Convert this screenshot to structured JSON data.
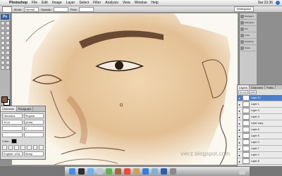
{
  "menubar": {
    "app_name": "Photoshop",
    "items": [
      "File",
      "Edit",
      "Image",
      "Layer",
      "Select",
      "Filter",
      "Analysis",
      "View",
      "Window",
      "Help"
    ],
    "clock": "Sat 23:36"
  },
  "optionsbar": {
    "mode_label": "Mode:",
    "mode_value": "Normal",
    "opacity_label": "Opacity:",
    "flow_label": "Flow:",
    "workspace_label": "Workspace"
  },
  "toolbox": {
    "badge": "Ps"
  },
  "character_panel": {
    "tabs": [
      "Character",
      "Paragraph"
    ],
    "font_family": "Helvetica",
    "font_style": "Regular",
    "size": "12 pt",
    "leading": "(Auto)",
    "tracking": "0",
    "color_label": "Color:",
    "language": "English: USA",
    "aa": "Sharp"
  },
  "right_dock": {
    "items": [
      "Navigator",
      "Histogram",
      "Info",
      "Color",
      "Swatches",
      "Styles"
    ]
  },
  "layers_panel": {
    "tabs": [
      "Layers",
      "Channels",
      "Paths"
    ],
    "blend": "Normal",
    "opacity": "100%",
    "layers": [
      "Layer 10",
      "Layer 1",
      "Layer 3",
      "Layer 9",
      "Layer copy",
      "Layer 6",
      "Layer 5",
      "Layer 4",
      "Layer 7",
      "Layer 2",
      "Layer 8"
    ]
  },
  "watermark": "vierz.blogspot.com",
  "colors": {
    "skin": "#e8c9a0",
    "shadow": "#b98257",
    "hair": "#6b4a34",
    "layer_selected": "#4d7cc9"
  },
  "dock": {
    "apps": [
      "Finder",
      "Dashboard",
      "Safari",
      "Mail",
      "iChat",
      "Address Book",
      "iCal",
      "Preview",
      "iTunes",
      "iPhoto",
      "Photoshop",
      "System Preferences",
      "Trash"
    ]
  }
}
